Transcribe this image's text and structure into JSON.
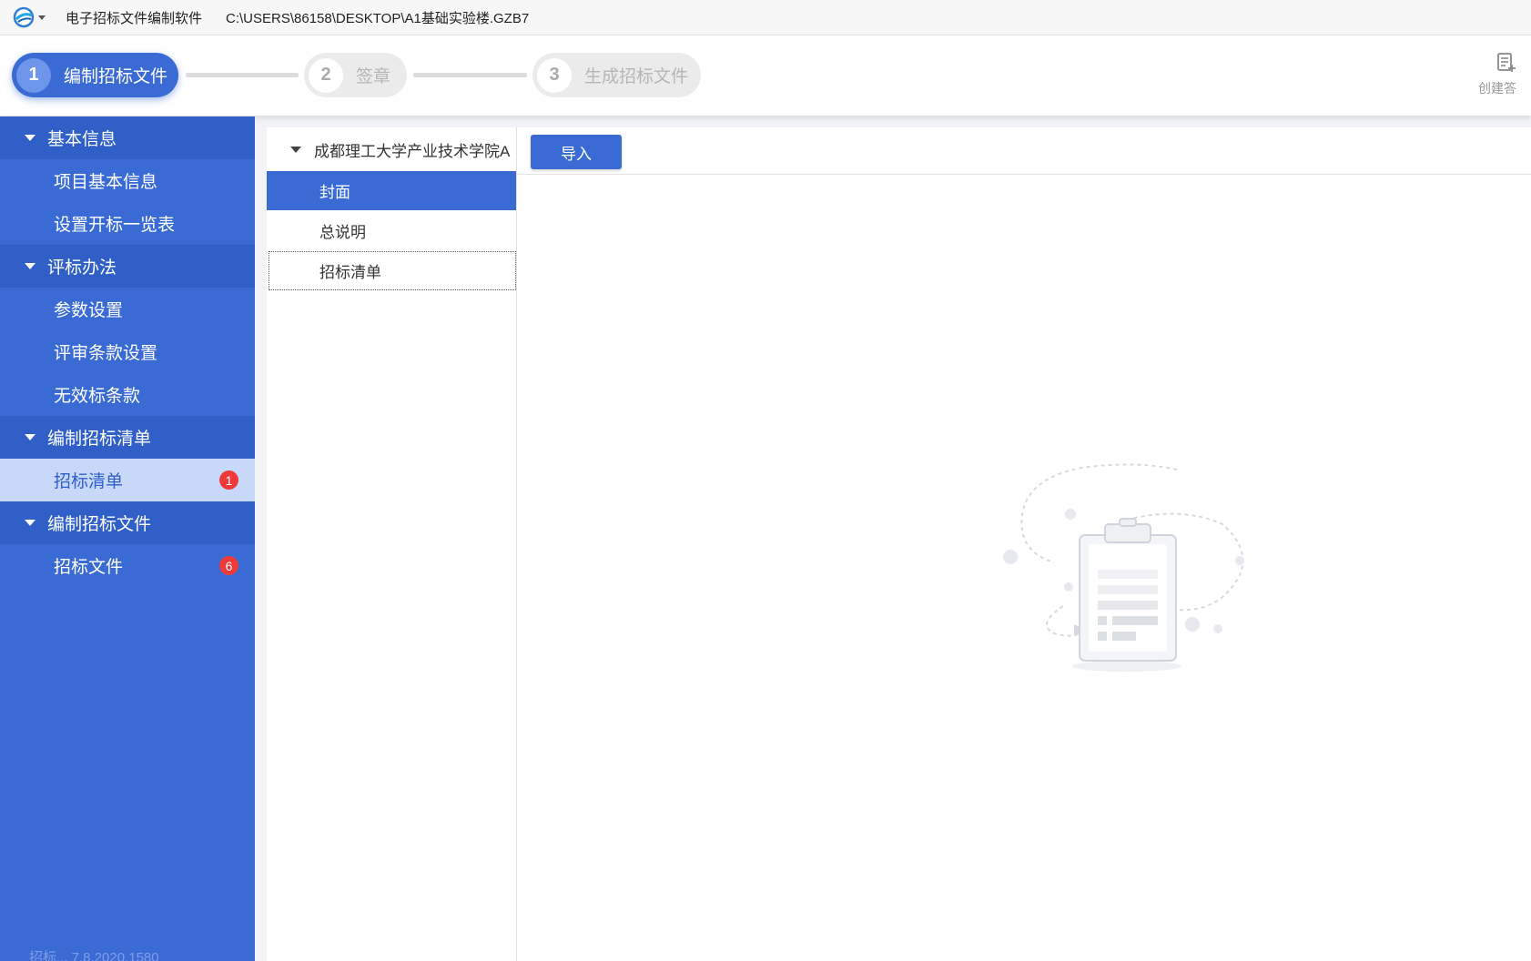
{
  "titlebar": {
    "app_name": "电子招标文件编制软件",
    "file_path": "C:\\USERS\\86158\\DESKTOP\\A1基础实验楼.GZB7"
  },
  "steps": [
    {
      "num": "1",
      "label": "编制招标文件",
      "state": "active"
    },
    {
      "num": "2",
      "label": "签章",
      "state": "inactive"
    },
    {
      "num": "3",
      "label": "生成招标文件",
      "state": "inactive"
    }
  ],
  "toolbar": {
    "create_label": "创建答",
    "create_icon": "create-document-icon"
  },
  "sidebar": {
    "groups": [
      {
        "title": "基本信息",
        "items": [
          {
            "label": "项目基本信息"
          },
          {
            "label": "设置开标一览表"
          }
        ]
      },
      {
        "title": "评标办法",
        "items": [
          {
            "label": "参数设置"
          },
          {
            "label": "评审条款设置"
          },
          {
            "label": "无效标条款"
          }
        ]
      },
      {
        "title": "编制招标清单",
        "items": [
          {
            "label": "招标清单",
            "badge": "1",
            "selected": true
          }
        ]
      },
      {
        "title": "编制招标文件",
        "items": [
          {
            "label": "招标文件",
            "badge": "6"
          }
        ]
      }
    ],
    "version": "招标... 7.8.2020.1580"
  },
  "tree": {
    "root": "成都理工大学产业技术学院A",
    "nodes": [
      {
        "label": "封面",
        "selected": true
      },
      {
        "label": "总说明"
      },
      {
        "label": "招标清单",
        "focused": true
      }
    ]
  },
  "content": {
    "import_label": "导入"
  },
  "colors": {
    "accent": "#3a6bd5",
    "sidebar_header": "#2f5fc7",
    "selected_item_bg": "#c7d8f8",
    "badge": "#f03a3a"
  }
}
